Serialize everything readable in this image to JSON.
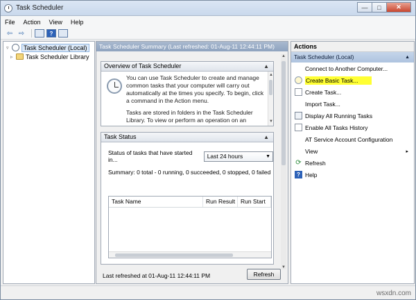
{
  "window": {
    "title": "Task Scheduler",
    "min_label": "—",
    "max_label": "□",
    "close_label": "✕"
  },
  "menu": [
    "File",
    "Action",
    "View",
    "Help"
  ],
  "toolbar": {
    "back_glyph": "⇦",
    "forward_glyph": "⇨",
    "help_glyph": "?"
  },
  "tree": {
    "items": [
      {
        "label": "Task Scheduler (Local)",
        "expander": "▿",
        "selected": true
      },
      {
        "label": "Task Scheduler Library",
        "expander": "▹",
        "selected": false
      }
    ]
  },
  "center": {
    "header": "Task Scheduler Summary (Last refreshed: 01-Aug-11 12:44:11 PM)",
    "overview": {
      "title": "Overview of Task Scheduler",
      "para1": "You can use Task Scheduler to create and manage common tasks that your computer will carry out automatically at the times you specify. To begin, click a command in the Action menu.",
      "para2": "Tasks are stored in folders in the Task Scheduler Library. To view or perform an operation on an individual task, select the task in the Task Scheduler Library and click on a command in the Action menu."
    },
    "task_status": {
      "title": "Task Status",
      "status_label": "Status of tasks that have started in...",
      "period": "Last 24 hours",
      "summary": "Summary: 0 total - 0 running, 0 succeeded, 0 stopped, 0 failed",
      "columns": [
        "Task Name",
        "Run Result",
        "Run Start"
      ]
    },
    "last_refreshed": "Last refreshed at 01-Aug-11 12:44:11 PM",
    "refresh_button": "Refresh"
  },
  "actions": {
    "title": "Actions",
    "group": "Task Scheduler (Local)",
    "items": [
      {
        "label": "Connect to Another Computer...",
        "icon": "none"
      },
      {
        "label": "Create Basic Task...",
        "icon": "create-basic-task-icon",
        "highlight": true
      },
      {
        "label": "Create Task...",
        "icon": "create-task-icon"
      },
      {
        "label": "Import Task...",
        "icon": "none"
      },
      {
        "label": "Display All Running Tasks",
        "icon": "running-tasks-icon"
      },
      {
        "label": "Enable All Tasks History",
        "icon": "history-icon"
      },
      {
        "label": "AT Service Account Configuration",
        "icon": "none"
      },
      {
        "label": "View",
        "icon": "none",
        "submenu": "▸"
      },
      {
        "label": "Refresh",
        "icon": "refresh-icon",
        "glyph": "⟳"
      },
      {
        "label": "Help",
        "icon": "help-icon",
        "glyph": "?"
      }
    ]
  },
  "watermark": "wsxdn.com",
  "colors": {
    "highlight": "#ffff33",
    "header_blue": "#8ea3bf",
    "selection": "#dce9f8"
  }
}
